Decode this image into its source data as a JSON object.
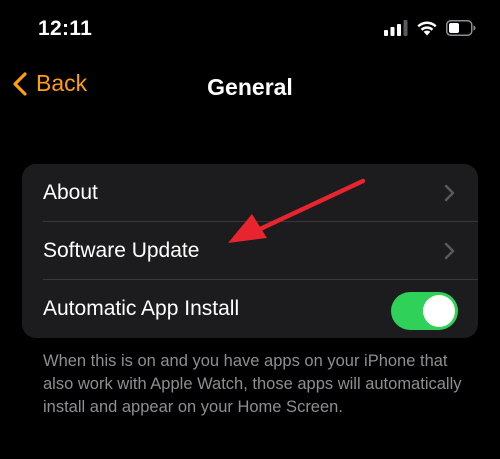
{
  "status_bar": {
    "time": "12:11",
    "icons": [
      "signal-icon",
      "wifi-icon",
      "battery-icon"
    ]
  },
  "nav": {
    "back_label": "Back",
    "title": "General"
  },
  "settings": {
    "rows": [
      {
        "label": "About",
        "accessory": "chevron"
      },
      {
        "label": "Software Update",
        "accessory": "chevron"
      },
      {
        "label": "Automatic App Install",
        "accessory": "toggle",
        "toggle_on": true
      }
    ]
  },
  "footer": {
    "text": "When this is on and you have apps on your iPhone that also work with Apple Watch, those apps will automatically install and appear on your Home Screen."
  },
  "colors": {
    "accent": "#ff9f0a",
    "toggle_on": "#30d158",
    "group_background": "#1c1c1e",
    "annotation_arrow": "#e8242f"
  }
}
